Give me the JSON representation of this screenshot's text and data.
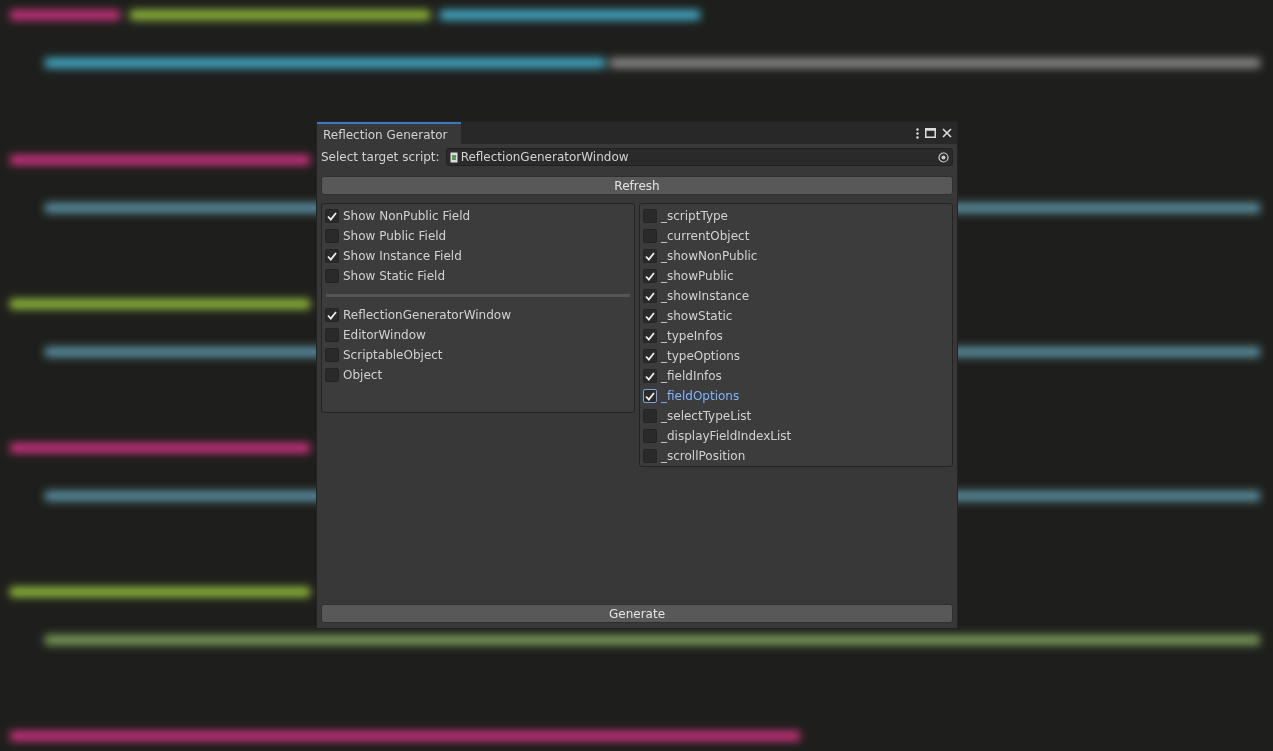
{
  "window": {
    "title": "Reflection Generator"
  },
  "target_script": {
    "label": "Select target script:",
    "value": "ReflectionGeneratorWindow"
  },
  "refresh_button": "Refresh",
  "filter_options": [
    {
      "label": "Show NonPublic Field",
      "checked": true
    },
    {
      "label": "Show Public Field",
      "checked": false
    },
    {
      "label": "Show Instance Field",
      "checked": true
    },
    {
      "label": "Show Static Field",
      "checked": false
    }
  ],
  "types": [
    {
      "label": "ReflectionGeneratorWindow",
      "checked": true
    },
    {
      "label": "EditorWindow",
      "checked": false
    },
    {
      "label": "ScriptableObject",
      "checked": false
    },
    {
      "label": "Object",
      "checked": false
    }
  ],
  "fields": [
    {
      "label": "_scriptType",
      "checked": false,
      "focused": false
    },
    {
      "label": "_currentObject",
      "checked": false,
      "focused": false
    },
    {
      "label": "_showNonPublic",
      "checked": true,
      "focused": false
    },
    {
      "label": "_showPublic",
      "checked": true,
      "focused": false
    },
    {
      "label": "_showInstance",
      "checked": true,
      "focused": false
    },
    {
      "label": "_showStatic",
      "checked": true,
      "focused": false
    },
    {
      "label": "_typeInfos",
      "checked": true,
      "focused": false
    },
    {
      "label": "_typeOptions",
      "checked": true,
      "focused": false
    },
    {
      "label": "_fieldInfos",
      "checked": true,
      "focused": false
    },
    {
      "label": "_fieldOptions",
      "checked": true,
      "focused": true
    },
    {
      "label": "_selectTypeList",
      "checked": false,
      "focused": false
    },
    {
      "label": "_displayFieldIndexList",
      "checked": false,
      "focused": false
    },
    {
      "label": "_scrollPosition",
      "checked": false,
      "focused": false
    }
  ],
  "generate_button": "Generate"
}
